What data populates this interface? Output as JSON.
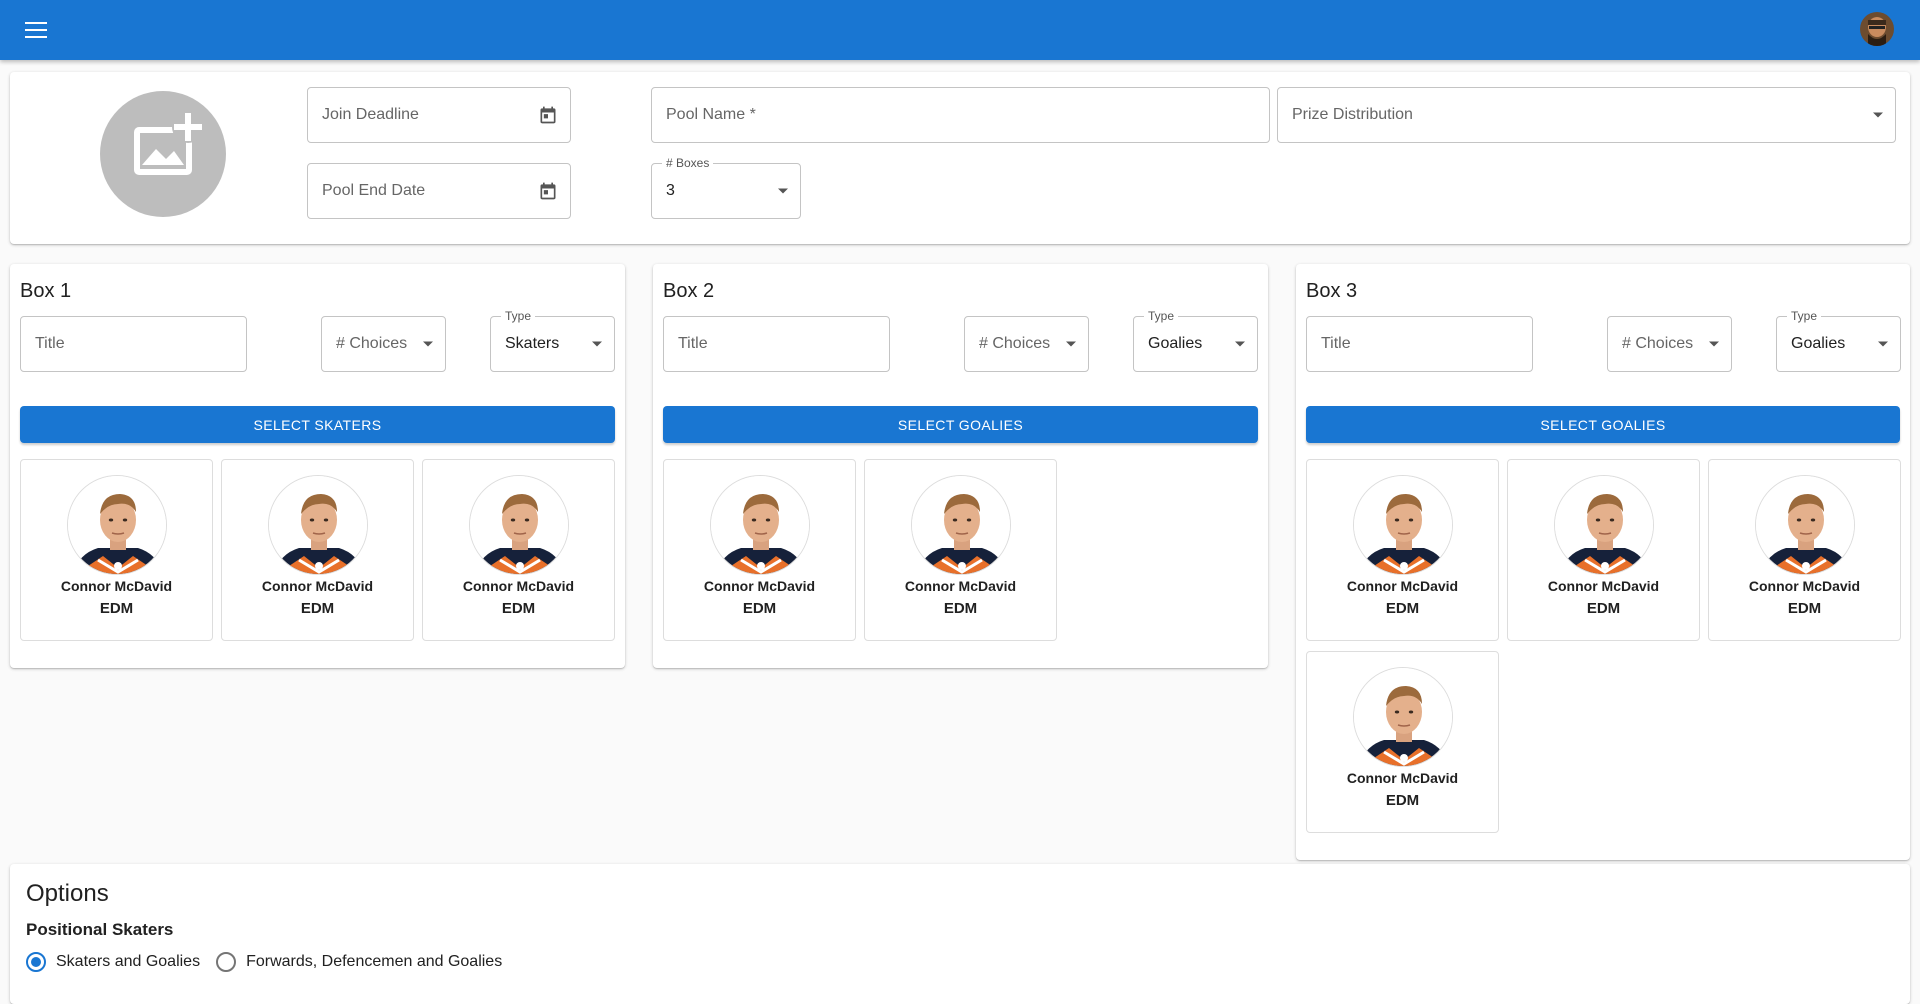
{
  "appbar": {
    "menu_icon": "menu-icon",
    "avatar_icon": "user-avatar"
  },
  "pool": {
    "join_deadline": {
      "placeholder": "Join Deadline",
      "icon": "calendar-icon"
    },
    "pool_end_date": {
      "placeholder": "Pool End Date",
      "icon": "calendar-icon"
    },
    "pool_name": {
      "placeholder": "Pool Name *"
    },
    "prize_distribution": {
      "placeholder": "Prize Distribution"
    },
    "num_boxes": {
      "label": "# Boxes",
      "value": "3"
    },
    "image_icon": "add-photo-icon"
  },
  "boxes": [
    {
      "title": "Box 1",
      "title_placeholder": "Title",
      "choices_placeholder": "# Choices",
      "type_label": "Type",
      "type_value": "Skaters",
      "button": "SELECT SKATERS",
      "players": [
        {
          "name": "Connor McDavid",
          "team": "EDM"
        },
        {
          "name": "Connor McDavid",
          "team": "EDM"
        },
        {
          "name": "Connor McDavid",
          "team": "EDM"
        }
      ]
    },
    {
      "title": "Box 2",
      "title_placeholder": "Title",
      "choices_placeholder": "# Choices",
      "type_label": "Type",
      "type_value": "Goalies",
      "button": "SELECT GOALIES",
      "players": [
        {
          "name": "Connor McDavid",
          "team": "EDM"
        },
        {
          "name": "Connor McDavid",
          "team": "EDM"
        }
      ]
    },
    {
      "title": "Box 3",
      "title_placeholder": "Title",
      "choices_placeholder": "# Choices",
      "type_label": "Type",
      "type_value": "Goalies",
      "button": "SELECT GOALIES",
      "players": [
        {
          "name": "Connor McDavid",
          "team": "EDM"
        },
        {
          "name": "Connor McDavid",
          "team": "EDM"
        },
        {
          "name": "Connor McDavid",
          "team": "EDM"
        },
        {
          "name": "Connor McDavid",
          "team": "EDM"
        }
      ]
    }
  ],
  "options": {
    "title": "Options",
    "positional_label": "Positional Skaters",
    "radios": [
      {
        "label": "Skaters and Goalies",
        "selected": true
      },
      {
        "label": "Forwards, Defencemen and Goalies",
        "selected": false
      }
    ]
  },
  "colors": {
    "primary": "#1976d2"
  }
}
